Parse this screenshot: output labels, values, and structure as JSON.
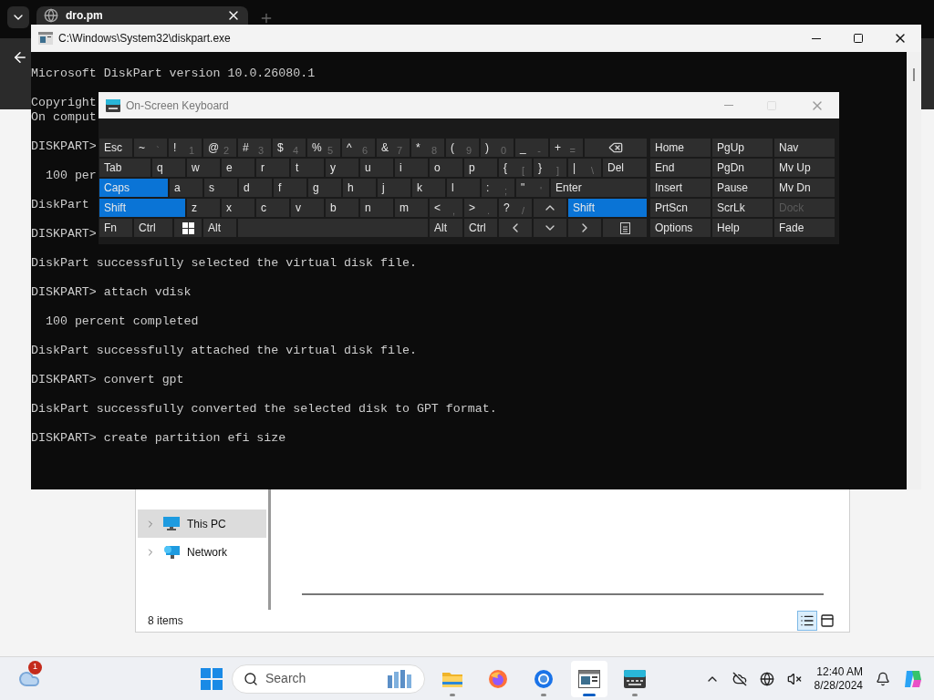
{
  "browser": {
    "tab_title": "dro.pm"
  },
  "console": {
    "title": "C:\\Windows\\System32\\diskpart.exe",
    "blocks": [
      [
        "Microsoft DiskPart version 10.0.26080.1"
      ],
      [
        "Copyright",
        "On comput"
      ],
      [
        "DISKPART>"
      ],
      [
        "  100 per"
      ],
      [
        "DiskPart"
      ],
      [
        "DISKPART>"
      ],
      [
        "DiskPart successfully selected the virtual disk file."
      ],
      [
        "DISKPART> attach vdisk"
      ],
      [
        "  100 percent completed"
      ],
      [
        "DiskPart successfully attached the virtual disk file."
      ],
      [
        "DISKPART> convert gpt"
      ],
      [
        "DiskPart successfully converted the selected disk to GPT format."
      ],
      [
        "DISKPART> create partition efi size"
      ]
    ]
  },
  "keyboard": {
    "title": "On-Screen Keyboard",
    "rows": [
      {
        "keys": [
          {
            "kind": "text",
            "label": "Esc",
            "on": false
          },
          {
            "kind": "pair",
            "label": "~",
            "sub": "`",
            "on": false
          },
          {
            "kind": "pair",
            "label": "!",
            "sub": "1",
            "on": false
          },
          {
            "kind": "pair",
            "label": "@",
            "sub": "2",
            "on": false
          },
          {
            "kind": "pair",
            "label": "#",
            "sub": "3",
            "on": false
          },
          {
            "kind": "pair",
            "label": "$",
            "sub": "4",
            "on": false
          },
          {
            "kind": "pair",
            "label": "%",
            "sub": "5",
            "on": false
          },
          {
            "kind": "pair",
            "label": "^",
            "sub": "6",
            "on": false
          },
          {
            "kind": "pair",
            "label": "&",
            "sub": "7",
            "on": false
          },
          {
            "kind": "pair",
            "label": "*",
            "sub": "8",
            "on": false
          },
          {
            "kind": "pair",
            "label": "(",
            "sub": "9",
            "on": false
          },
          {
            "kind": "pair",
            "label": ")",
            "sub": "0",
            "on": false
          },
          {
            "kind": "pair",
            "label": "_",
            "sub": "-",
            "on": false
          },
          {
            "kind": "pair",
            "label": "+",
            "sub": "=",
            "on": false
          },
          {
            "kind": "backspace",
            "on": false
          }
        ]
      },
      {
        "keys": [
          {
            "kind": "text",
            "label": "Tab",
            "on": false
          },
          {
            "kind": "text",
            "label": "q",
            "on": false
          },
          {
            "kind": "text",
            "label": "w",
            "on": false
          },
          {
            "kind": "text",
            "label": "e",
            "on": false
          },
          {
            "kind": "text",
            "label": "r",
            "on": false
          },
          {
            "kind": "text",
            "label": "t",
            "on": false
          },
          {
            "kind": "text",
            "label": "y",
            "on": false
          },
          {
            "kind": "text",
            "label": "u",
            "on": false
          },
          {
            "kind": "text",
            "label": "i",
            "on": false
          },
          {
            "kind": "text",
            "label": "o",
            "on": false
          },
          {
            "kind": "text",
            "label": "p",
            "on": false
          },
          {
            "kind": "pair",
            "label": "{",
            "sub": "[",
            "on": false
          },
          {
            "kind": "pair",
            "label": "}",
            "sub": "]",
            "on": false
          },
          {
            "kind": "pair",
            "label": "|",
            "sub": "\\",
            "on": false
          },
          {
            "kind": "text",
            "label": "Del",
            "on": false
          }
        ]
      },
      {
        "keys": [
          {
            "kind": "text",
            "label": "Caps",
            "on": true
          },
          {
            "kind": "text",
            "label": "a",
            "on": false
          },
          {
            "kind": "text",
            "label": "s",
            "on": false
          },
          {
            "kind": "text",
            "label": "d",
            "on": false
          },
          {
            "kind": "text",
            "label": "f",
            "on": false
          },
          {
            "kind": "text",
            "label": "g",
            "on": false
          },
          {
            "kind": "text",
            "label": "h",
            "on": false
          },
          {
            "kind": "text",
            "label": "j",
            "on": false
          },
          {
            "kind": "text",
            "label": "k",
            "on": false
          },
          {
            "kind": "text",
            "label": "l",
            "on": false
          },
          {
            "kind": "pair",
            "label": ":",
            "sub": ";",
            "on": false
          },
          {
            "kind": "pair",
            "label": "\"",
            "sub": "'",
            "on": false
          },
          {
            "kind": "text",
            "label": "Enter",
            "on": false
          }
        ]
      },
      {
        "keys": [
          {
            "kind": "text",
            "label": "Shift",
            "on": true
          },
          {
            "kind": "text",
            "label": "z",
            "on": false
          },
          {
            "kind": "text",
            "label": "x",
            "on": false
          },
          {
            "kind": "text",
            "label": "c",
            "on": false
          },
          {
            "kind": "text",
            "label": "v",
            "on": false
          },
          {
            "kind": "text",
            "label": "b",
            "on": false
          },
          {
            "kind": "text",
            "label": "n",
            "on": false
          },
          {
            "kind": "text",
            "label": "m",
            "on": false
          },
          {
            "kind": "pair",
            "label": "<",
            "sub": ",",
            "on": false
          },
          {
            "kind": "pair",
            "label": ">",
            "sub": ".",
            "on": false
          },
          {
            "kind": "pair",
            "label": "?",
            "sub": "/",
            "on": false
          },
          {
            "kind": "up",
            "on": false
          },
          {
            "kind": "text",
            "label": "Shift",
            "on": true
          }
        ]
      },
      {
        "keys": [
          {
            "kind": "text",
            "label": "Fn",
            "on": false
          },
          {
            "kind": "text",
            "label": "Ctrl",
            "on": false
          },
          {
            "kind": "windows",
            "on": false
          },
          {
            "kind": "text",
            "label": "Alt",
            "on": false
          },
          {
            "kind": "space",
            "on": false
          },
          {
            "kind": "text",
            "label": "Alt",
            "on": false
          },
          {
            "kind": "text",
            "label": "Ctrl",
            "on": false
          },
          {
            "kind": "left",
            "on": false
          },
          {
            "kind": "down",
            "on": false
          },
          {
            "kind": "right",
            "on": false
          },
          {
            "kind": "menu",
            "on": false
          }
        ]
      }
    ],
    "nav": [
      [
        {
          "label": "Home",
          "disabled": false
        },
        {
          "label": "PgUp",
          "disabled": false
        },
        {
          "label": "Nav",
          "disabled": false
        }
      ],
      [
        {
          "label": "End",
          "disabled": false
        },
        {
          "label": "PgDn",
          "disabled": false
        },
        {
          "label": "Mv Up",
          "disabled": false
        }
      ],
      [
        {
          "label": "Insert",
          "disabled": false
        },
        {
          "label": "Pause",
          "disabled": false
        },
        {
          "label": "Mv Dn",
          "disabled": false
        }
      ],
      [
        {
          "label": "PrtScn",
          "disabled": false
        },
        {
          "label": "ScrLk",
          "disabled": false
        },
        {
          "label": "Dock",
          "disabled": true
        }
      ],
      [
        {
          "label": "Options",
          "disabled": false
        },
        {
          "label": "Help",
          "disabled": false
        },
        {
          "label": "Fade",
          "disabled": false
        }
      ]
    ]
  },
  "explorer": {
    "sidebar": [
      {
        "kind": "pc",
        "label": "This PC",
        "selected": true
      },
      {
        "kind": "network",
        "label": "Network",
        "selected": false
      }
    ],
    "status": "8 items",
    "views": [
      {
        "kind": "details",
        "selected": true
      },
      {
        "kind": "tiles",
        "selected": false
      }
    ]
  },
  "taskbar": {
    "weather_badge": "1",
    "search_placeholder": "Search",
    "apps": [
      {
        "kind": "folder",
        "running": true,
        "selected": false
      },
      {
        "kind": "firefox",
        "running": false,
        "selected": false
      },
      {
        "kind": "chrome",
        "running": true,
        "selected": false
      },
      {
        "kind": "console",
        "running": true,
        "selected": true
      },
      {
        "kind": "keyboard",
        "running": true,
        "selected": false
      }
    ],
    "time": "12:40 AM",
    "date": "8/28/2024"
  }
}
